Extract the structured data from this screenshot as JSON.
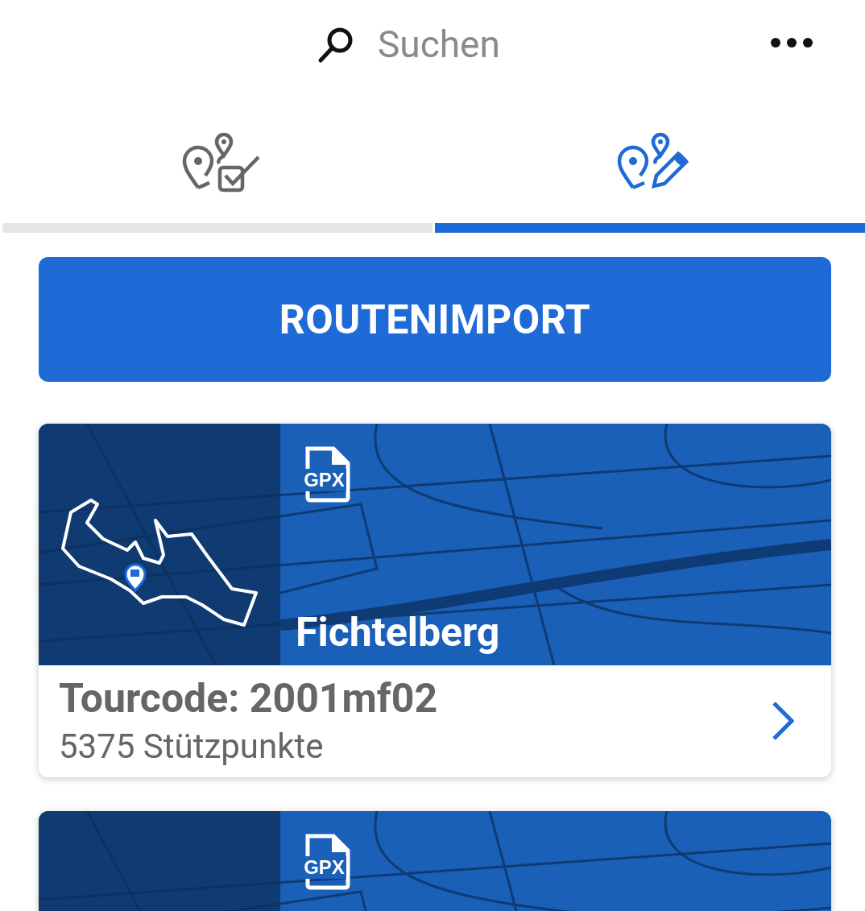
{
  "search": {
    "placeholder": "Suchen"
  },
  "tabs": [
    {
      "kind": "checklist",
      "selected": false
    },
    {
      "kind": "edit",
      "selected": true
    }
  ],
  "import_button": "ROUTENIMPORT",
  "routes": [
    {
      "badge": "GPX",
      "title": "Fichtelberg",
      "tourcode": "Tourcode: 2001mf02",
      "waypoints": "5375 Stützpunkte"
    },
    {
      "badge": "GPX"
    }
  ]
}
